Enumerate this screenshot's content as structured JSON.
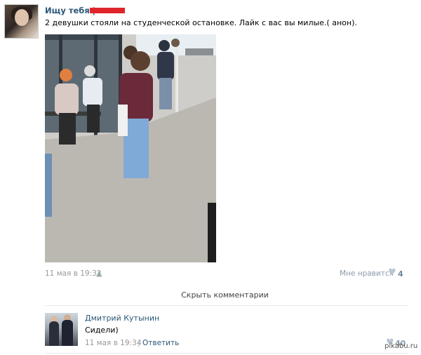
{
  "post": {
    "author": "Ищу тебя |",
    "text": "2 девушки стояли на студенческой остановке. Лайк с вас вы милые.( анон).",
    "date": "11 мая в 19:32",
    "likes_label": "Мне нравится",
    "likes_count": "4"
  },
  "comments_toggle": "Скрыть комментарии",
  "comment": {
    "author": "Дмитрий Кутынин",
    "text": "Сидели)",
    "date": "11 мая в 19:34",
    "separator": "|",
    "reply": "Ответить",
    "likes_count": "40"
  },
  "watermark": "pikabu.ru",
  "colors": {
    "link": "#2b587a",
    "redaction": "#e0252a",
    "meta": "#999999"
  }
}
